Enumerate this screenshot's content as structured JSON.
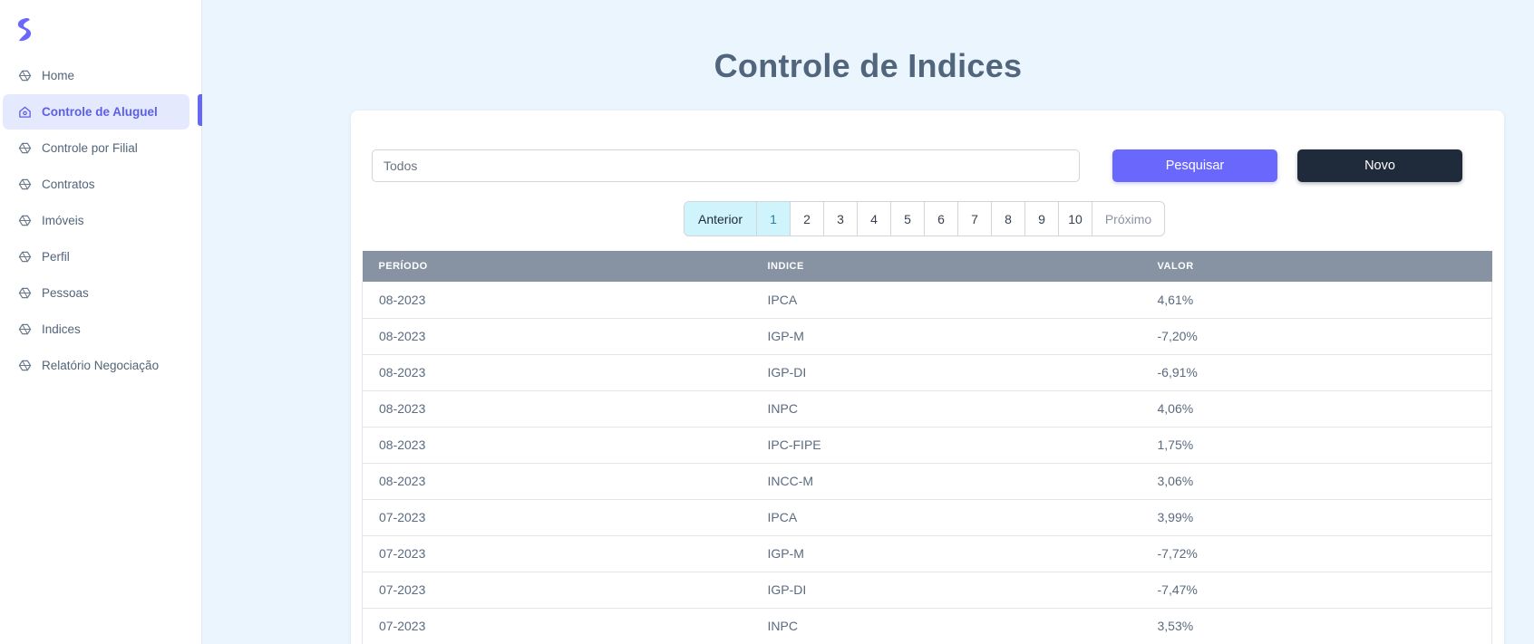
{
  "sidebar": {
    "items": [
      {
        "label": "Home",
        "active": false
      },
      {
        "label": "Controle de Aluguel",
        "active": true
      },
      {
        "label": "Controle por Filial",
        "active": false
      },
      {
        "label": "Contratos",
        "active": false
      },
      {
        "label": "Imóveis",
        "active": false
      },
      {
        "label": "Perfil",
        "active": false
      },
      {
        "label": "Pessoas",
        "active": false
      },
      {
        "label": "Indices",
        "active": false
      },
      {
        "label": "Relatório Negociação",
        "active": false
      }
    ]
  },
  "page": {
    "title": "Controle de Indices"
  },
  "toolbar": {
    "search_value": "Todos",
    "search_label": "Pesquisar",
    "new_label": "Novo"
  },
  "pagination": {
    "prev_label": "Anterior",
    "pages": [
      "1",
      "2",
      "3",
      "4",
      "5",
      "6",
      "7",
      "8",
      "9",
      "10"
    ],
    "current": "1",
    "next_label": "Próximo"
  },
  "table": {
    "headers": [
      "PERÍODO",
      "INDICE",
      "VALOR"
    ],
    "rows": [
      [
        "08-2023",
        "IPCA",
        "4,61%"
      ],
      [
        "08-2023",
        "IGP-M",
        "-7,20%"
      ],
      [
        "08-2023",
        "IGP-DI",
        "-6,91%"
      ],
      [
        "08-2023",
        "INPC",
        "4,06%"
      ],
      [
        "08-2023",
        "IPC-FIPE",
        "1,75%"
      ],
      [
        "08-2023",
        "INCC-M",
        "3,06%"
      ],
      [
        "07-2023",
        "IPCA",
        "3,99%"
      ],
      [
        "07-2023",
        "IGP-M",
        "-7,72%"
      ],
      [
        "07-2023",
        "IGP-DI",
        "-7,47%"
      ],
      [
        "07-2023",
        "INPC",
        "3,53%"
      ]
    ]
  },
  "colors": {
    "accent": "#6a67fd",
    "dark_button": "#1f2a3a",
    "header": "#8793a3",
    "background": "#ebf5fd",
    "active_nav_bg": "#e5e9fd",
    "page_active": "#d0f4fb"
  },
  "icons": {
    "logo": "brand-s-logo",
    "nav": "cube-outline-icon",
    "nav_active": "house-icon"
  }
}
